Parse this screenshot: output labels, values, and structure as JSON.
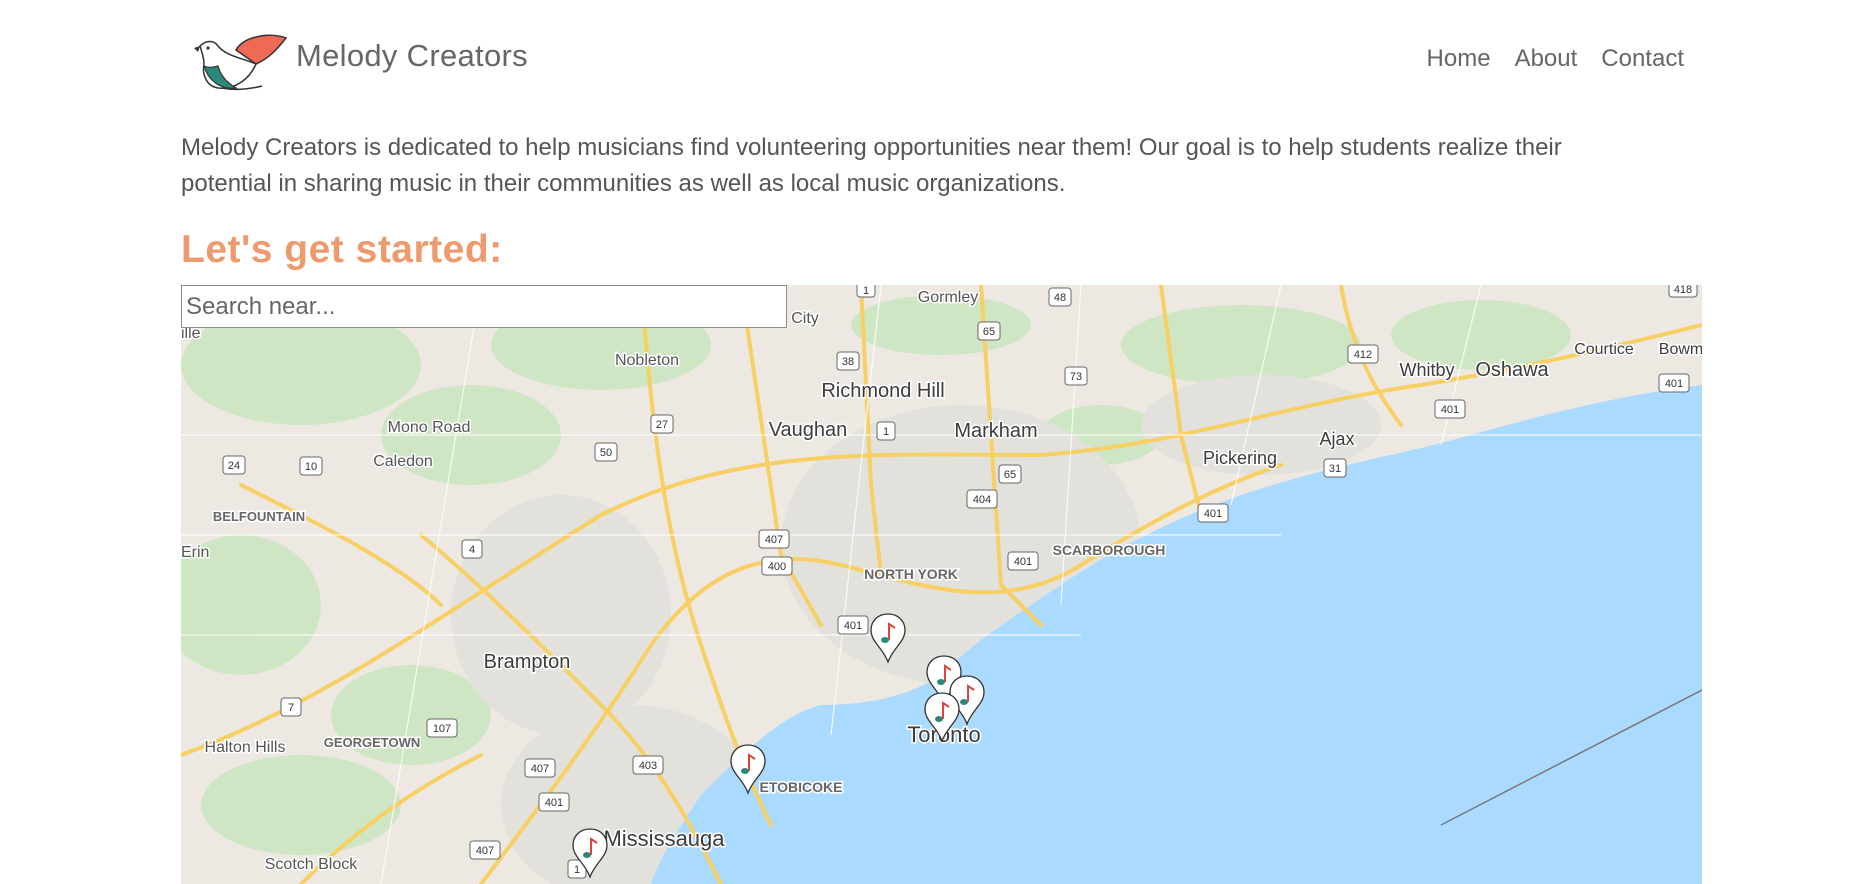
{
  "header": {
    "brand": "Melody Creators",
    "nav": [
      "Home",
      "About",
      "Contact"
    ]
  },
  "intro": "Melody Creators is dedicated to help musicians find volunteering opportunities near them! Our goal is to help students realize their potential in sharing music in their communities as well as local music organizations.",
  "cta_heading": "Let's get started:",
  "search": {
    "placeholder": "Search near..."
  },
  "map": {
    "cities": {
      "toronto": "Toronto",
      "mississauga": "Mississauga",
      "brampton": "Brampton",
      "vaughan": "Vaughan",
      "richmond_hill": "Richmond Hill",
      "markham": "Markham",
      "pickering": "Pickering",
      "ajax": "Ajax",
      "whitby": "Whitby",
      "oshawa": "Oshawa",
      "courtice": "Courtice",
      "bowm": "Bowm"
    },
    "places": {
      "gormley": "Gormley",
      "nobleton": "Nobleton",
      "mono_road": "Mono Road",
      "caledon": "Caledon",
      "belfountain": "BELFOUNTAIN",
      "erin": "Erin",
      "north_york": "NORTH YORK",
      "scarborough": "SCARBOROUGH",
      "etobicoke": "ETOBICOKE",
      "georgetown": "GEORGETOWN",
      "halton_hills": "Halton Hills",
      "scotch_block": "Scotch Block",
      "city_partial": "City",
      "ille_partial": "ille"
    },
    "highways": {
      "h1a": "1",
      "h48": "48",
      "h418": "418",
      "h65a": "65",
      "h38": "38",
      "h73": "73",
      "h412": "412",
      "h401a": "401",
      "h401b": "401",
      "h27": "27",
      "h50": "50",
      "h1b": "1",
      "h65b": "65",
      "h31": "31",
      "h24": "24",
      "h10": "10",
      "h404": "404",
      "h407a": "407",
      "h400": "400",
      "h401c": "401",
      "h4": "4",
      "h401d": "401",
      "h401e": "401",
      "h7": "7",
      "h107": "107",
      "h407b": "407",
      "h403": "403",
      "h401f": "401",
      "h407c": "407",
      "h1c": "1"
    },
    "marker_icon": "music-note-pin-icon",
    "colors": {
      "water": "#aadaff",
      "land": "#ede9e2",
      "highway": "#fcd36b",
      "park": "#c8e6c0",
      "accent": "#ef9a6e"
    }
  }
}
